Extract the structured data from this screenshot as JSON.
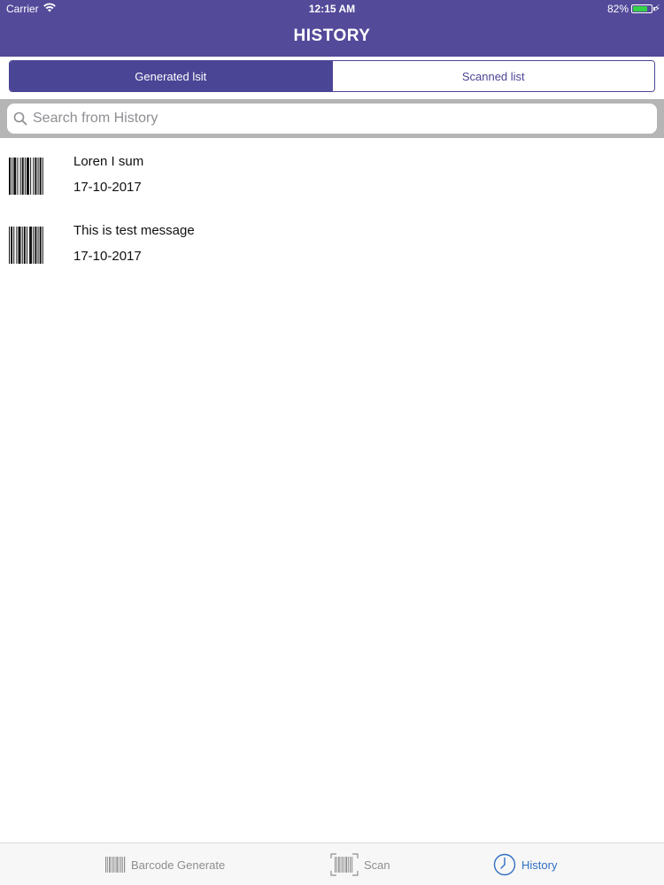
{
  "status_bar": {
    "carrier": "Carrier",
    "time": "12:15 AM",
    "battery_percent": "82%",
    "battery_level": 0.82,
    "battery_color": "#37d04a"
  },
  "nav": {
    "title": "HISTORY",
    "background": "#544a9a"
  },
  "segments": {
    "generated_label": "Generated lsit",
    "scanned_label": "Scanned list",
    "selected": "generated"
  },
  "search": {
    "placeholder": "Search from History",
    "value": ""
  },
  "history": {
    "items": [
      {
        "title": "Loren I sum",
        "date": "17-10-2017",
        "icon": "barcode-icon"
      },
      {
        "title": "This is test message",
        "date": "17-10-2017",
        "icon": "barcode-icon"
      }
    ]
  },
  "tabbar": {
    "tabs": [
      {
        "label": "Barcode Generate",
        "icon": "barcode-icon"
      },
      {
        "label": "Scan",
        "icon": "barcode-scan-icon"
      },
      {
        "label": "History",
        "icon": "clock-icon"
      }
    ],
    "selected": "History",
    "selected_color": "#2f6fc4"
  }
}
